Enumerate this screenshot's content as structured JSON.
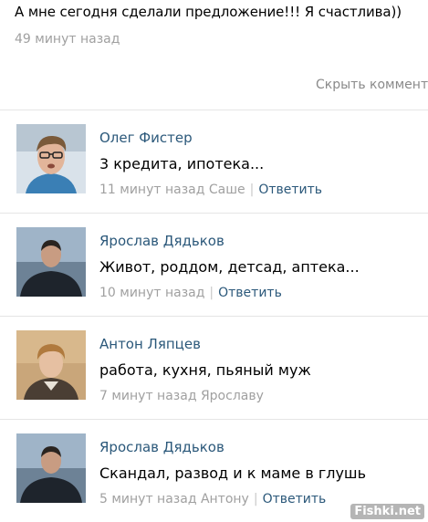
{
  "post": {
    "text": "А мне сегодня сделали предложение!!! Я счастлива))",
    "time": "49 минут назад"
  },
  "hide_comments_label": "Скрыть коммент",
  "comments": [
    {
      "author": "Олег Фистер",
      "text": "3 кредита, ипотека...",
      "time": "11 минут назад Саше",
      "reply": "Ответить",
      "avatar_icon": "user-avatar-photo"
    },
    {
      "author": "Ярослав Дядьков",
      "text": "Живот, роддом, детсад, аптека...",
      "time": "10 минут назад",
      "reply": "Ответить",
      "avatar_icon": "user-avatar-photo"
    },
    {
      "author": "Антон Ляпцев",
      "text": "работа, кухня, пьяный муж",
      "time": "7 минут назад Ярославу",
      "reply": "",
      "avatar_icon": "user-avatar-photo"
    },
    {
      "author": "Ярослав Дядьков",
      "text": "Скандал, развод и к маме в глушь",
      "time": "5 минут назад Антону",
      "reply": "Ответить",
      "avatar_icon": "user-avatar-photo"
    }
  ],
  "watermark": "Fishki.net",
  "colors": {
    "link": "#2b587a",
    "meta": "#a0a0a0",
    "divider": "#e5e5e5"
  }
}
